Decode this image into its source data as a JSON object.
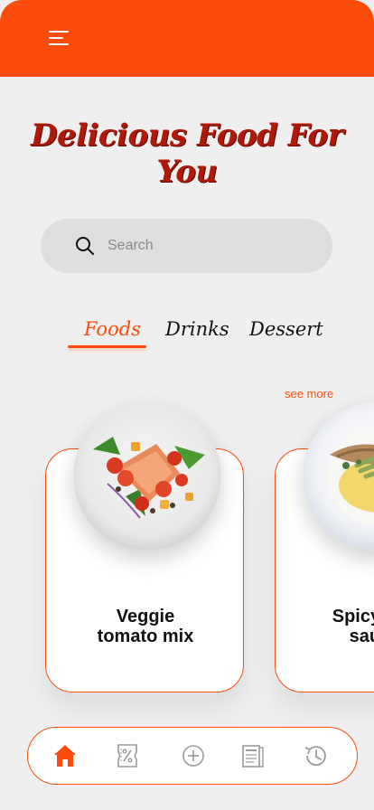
{
  "header": {
    "menu_icon": "hamburger-menu-icon"
  },
  "hero": {
    "title": "Delicious Food For You"
  },
  "search": {
    "placeholder": "Search",
    "icon": "search-icon"
  },
  "tabs": [
    {
      "label": "Foods",
      "active": true
    },
    {
      "label": "Drinks",
      "active": false
    },
    {
      "label": "Dessert",
      "active": false
    }
  ],
  "see_more": "see more",
  "cards": [
    {
      "name": "Veggie\ntomato mix",
      "image": "salmon-veggie-plate"
    },
    {
      "name": "Spicy fish\nsauce",
      "image": "fish-sauce-plate"
    }
  ],
  "bottom_nav": [
    {
      "icon": "home-icon",
      "active": true
    },
    {
      "icon": "discount-ticket-icon",
      "active": false
    },
    {
      "icon": "add-circle-icon",
      "active": false
    },
    {
      "icon": "menu-icon",
      "active": false
    },
    {
      "icon": "history-icon",
      "active": false
    }
  ],
  "colors": {
    "accent": "#fb4c0b",
    "title": "#b0190a",
    "background": "#efefef"
  }
}
